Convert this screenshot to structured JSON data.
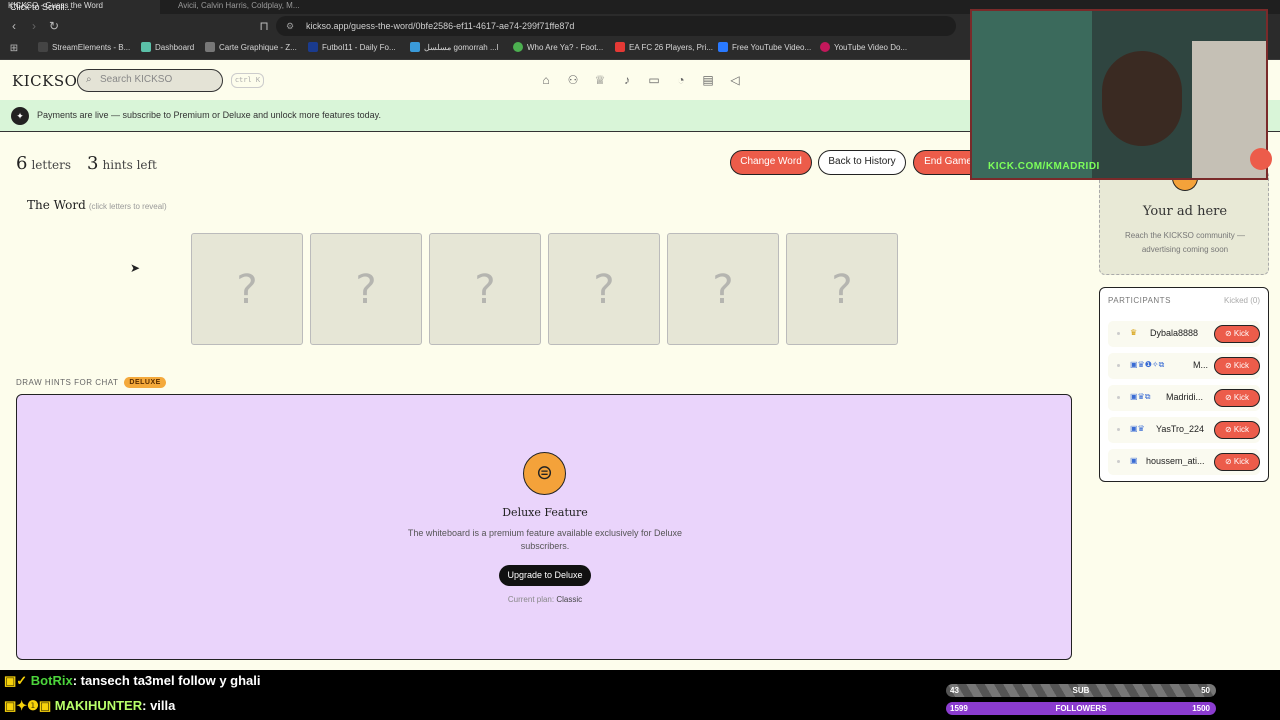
{
  "browser": {
    "tabs": [
      {
        "label": "KICKSO - Guess the Word",
        "active": true
      },
      {
        "label": "Avicii, Calvin Harris, Coldplay, M...",
        "active": false
      }
    ],
    "stream_overlay_top": "Click to Scroll... ",
    "url": "kickso.app/guess-the-word/0bfe2586-ef11-4617-ae74-299f71ffe87d",
    "bookmarks": [
      {
        "label": "StreamElements - B...",
        "color": "#222222"
      },
      {
        "label": "Dashboard",
        "color": "#5bc0a8"
      },
      {
        "label": "Carte Graphique - Z...",
        "color": "#777777"
      },
      {
        "label": "Futbol11 - Daily Fo...",
        "color": "#1a3b8f"
      },
      {
        "label": "مسلسل gomorrah ...l",
        "color": "#3a9ad9"
      },
      {
        "label": "Who Are Ya? - Foot...",
        "color": "#4caf50"
      },
      {
        "label": "EA FC 26 Players, Pri...",
        "color": "#e53935"
      },
      {
        "label": "Free YouTube Video...",
        "color": "#2979ff"
      },
      {
        "label": "YouTube Video Do...",
        "color": "#c2185b"
      }
    ]
  },
  "site": {
    "logo": "KICKSO",
    "search_placeholder": "Search KICKSO",
    "shortcut": "ctrl K",
    "nav_icons": [
      "home-icon",
      "users-icon",
      "trophy-icon",
      "mic-icon",
      "monitor-icon",
      "chart-icon",
      "news-icon",
      "megaphone-icon"
    ],
    "banner": "Payments are live — subscribe to Premium or Deluxe and unlock more features today."
  },
  "game": {
    "letters_count": "6",
    "letters_label": "letters",
    "hints_count": "3",
    "hints_label": "hints left",
    "buttons": {
      "change_word": "Change Word",
      "back_history": "Back to History",
      "end_game": "End Game"
    },
    "word_title": "The Word",
    "word_hint": "(click letters to reveal)",
    "tiles": [
      "?",
      "?",
      "?",
      "?",
      "?",
      "?"
    ],
    "draw_label": "DRAW HINTS FOR CHAT",
    "draw_badge": "DELUXE",
    "deluxe_title": "Deluxe Feature",
    "deluxe_desc": "The whiteboard is a premium feature available exclusively for Deluxe subscribers.",
    "upgrade_label": "Upgrade to Deluxe",
    "plan_label": "Current plan:",
    "plan_value": "Classic"
  },
  "sidebar": {
    "ad_title": "Your ad here",
    "ad_desc": "Reach the KICKSO community — advertising coming soon",
    "participants_title": "PARTICIPANTS",
    "kicked_label": "Kicked (0)",
    "kick_label": "Kick",
    "participants": [
      {
        "name": "Dybala8888",
        "badges": "♛"
      },
      {
        "name": "M...",
        "badges": "▣♛❶✧⧉"
      },
      {
        "name": "Madridi...",
        "badges": "▣♛⧉"
      },
      {
        "name": "YasTro_224",
        "badges": "▣♛"
      },
      {
        "name": "houssem_ati...",
        "badges": "▣"
      }
    ]
  },
  "webcam": {
    "caption": "KICK.COM/KMADRIDI"
  },
  "stream": {
    "chat": [
      {
        "user": "BotRix",
        "msg": ": tansech ta3mel follow y ghali"
      },
      {
        "user": "MAKIHUNTER",
        "msg": ": villa"
      }
    ],
    "sub_bar": {
      "current": "43",
      "label": "SUB",
      "goal": "50"
    },
    "followers_bar": {
      "current": "1599",
      "label": "FOLLOWERS",
      "goal": "1500"
    }
  }
}
